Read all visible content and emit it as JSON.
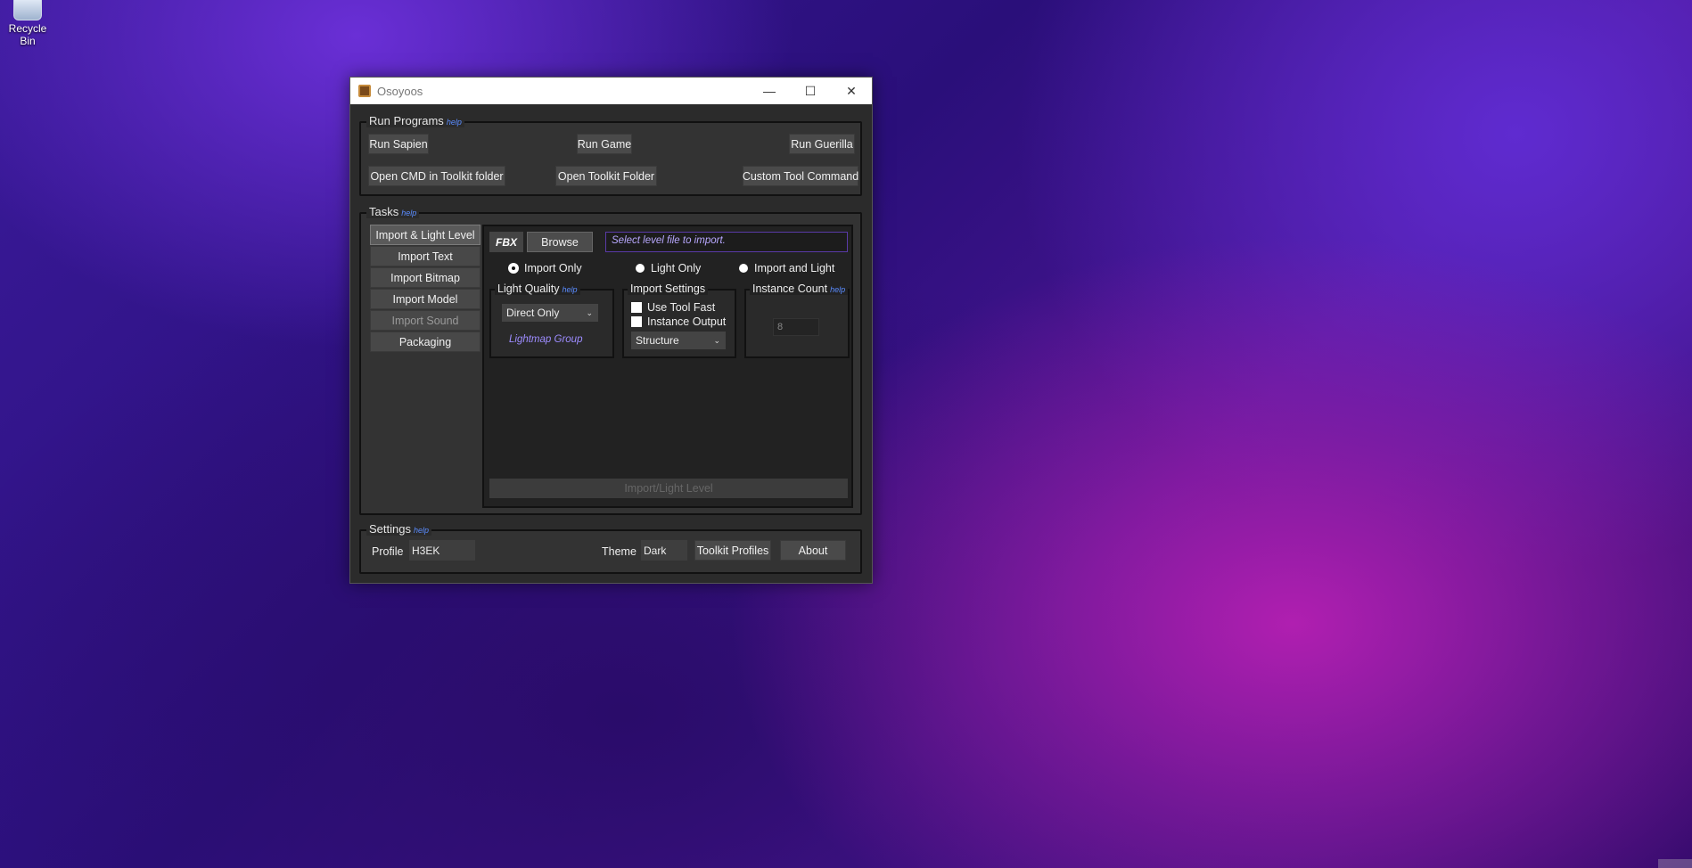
{
  "desktop": {
    "recycle_bin_label": "Recycle Bin"
  },
  "window": {
    "title": "Osoyoos",
    "minimize": "—",
    "maximize": "☐",
    "close": "✕"
  },
  "run_programs": {
    "label": "Run Programs",
    "help": "help",
    "buttons": [
      "Run Sapien",
      "Run Game",
      "Run Guerilla",
      "Open CMD in Toolkit folder",
      "Open Toolkit Folder",
      "Custom Tool Command"
    ]
  },
  "tasks": {
    "label": "Tasks",
    "help": "help",
    "items": [
      "Import & Light Level",
      "Import Text",
      "Import Bitmap",
      "Import Model",
      "Import Sound",
      "Packaging"
    ],
    "active_index": 0,
    "panel": {
      "fbx_tag": "FBX",
      "browse": "Browse",
      "file_placeholder": "Select level file to import.",
      "radios": [
        "Import Only",
        "Light Only",
        "Import and Light"
      ],
      "radio_selected": "Import Only",
      "light_quality": {
        "label": "Light Quality",
        "help": "help",
        "value": "Direct Only",
        "lightmap_group": "Lightmap Group"
      },
      "import_settings": {
        "label": "Import Settings",
        "use_tool_fast": "Use Tool Fast",
        "instance_output": "Instance Output",
        "type_value": "Structure"
      },
      "instance_count": {
        "label": "Instance Count",
        "help": "help",
        "value": "8"
      },
      "action": "Import/Light Level"
    }
  },
  "settings": {
    "label": "Settings",
    "help": "help",
    "profile_label": "Profile",
    "profile_value": "H3EK",
    "theme_label": "Theme",
    "theme_value": "Dark",
    "toolkit_profiles": "Toolkit Profiles",
    "about": "About"
  }
}
